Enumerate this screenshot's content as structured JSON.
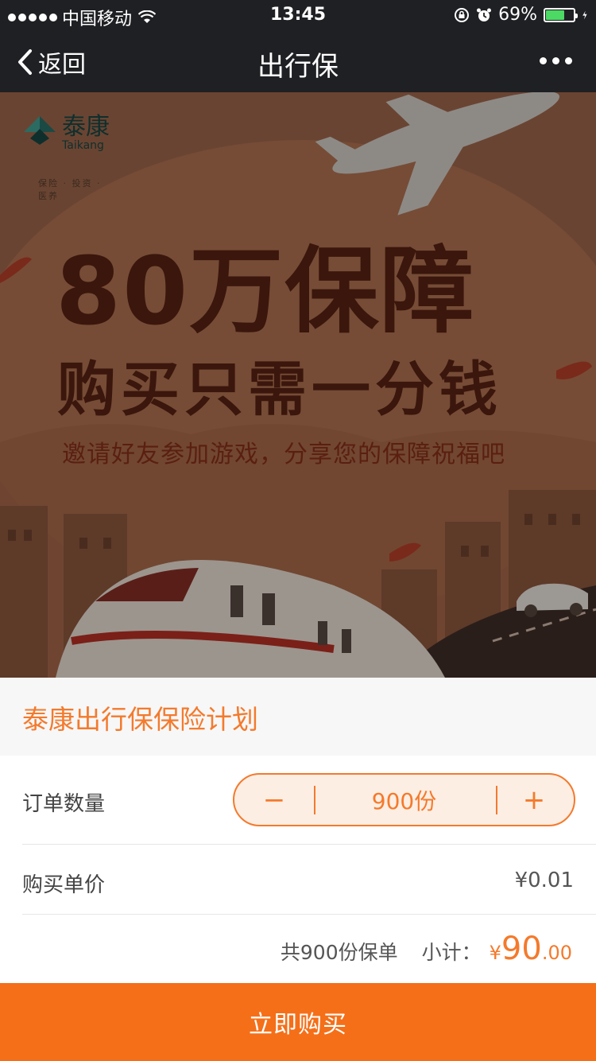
{
  "status_bar": {
    "carrier": "中国移动",
    "time": "13:45",
    "battery_text": "69%",
    "battery_level": 0.69
  },
  "nav": {
    "back_label": "返回",
    "title": "出行保"
  },
  "banner": {
    "logo_cn": "泰康",
    "logo_en": "Taikang",
    "logo_sub": "保险 · 投资 · 医养",
    "headline_line1": "80万保障",
    "headline_line2": "购买只需一分钱",
    "headline_line3": "邀请好友参加游戏，分享您的保障祝福吧"
  },
  "plan": {
    "title": "泰康出行保保险计划"
  },
  "order": {
    "quantity_label": "订单数量",
    "minus_symbol": "−",
    "plus_symbol": "+",
    "quantity_value": "900份",
    "unit_price_label": "购买单价",
    "unit_price_value": "¥0.01",
    "total_count": "共900份保单",
    "subtotal_label": "小计：",
    "currency": "¥",
    "amount_integer": "90",
    "amount_decimal": ".00"
  },
  "actions": {
    "buy_label": "立即购买"
  },
  "colors": {
    "accent": "#f47a2c",
    "buy_button": "#f56f18",
    "bar_bg": "#1f2023"
  }
}
